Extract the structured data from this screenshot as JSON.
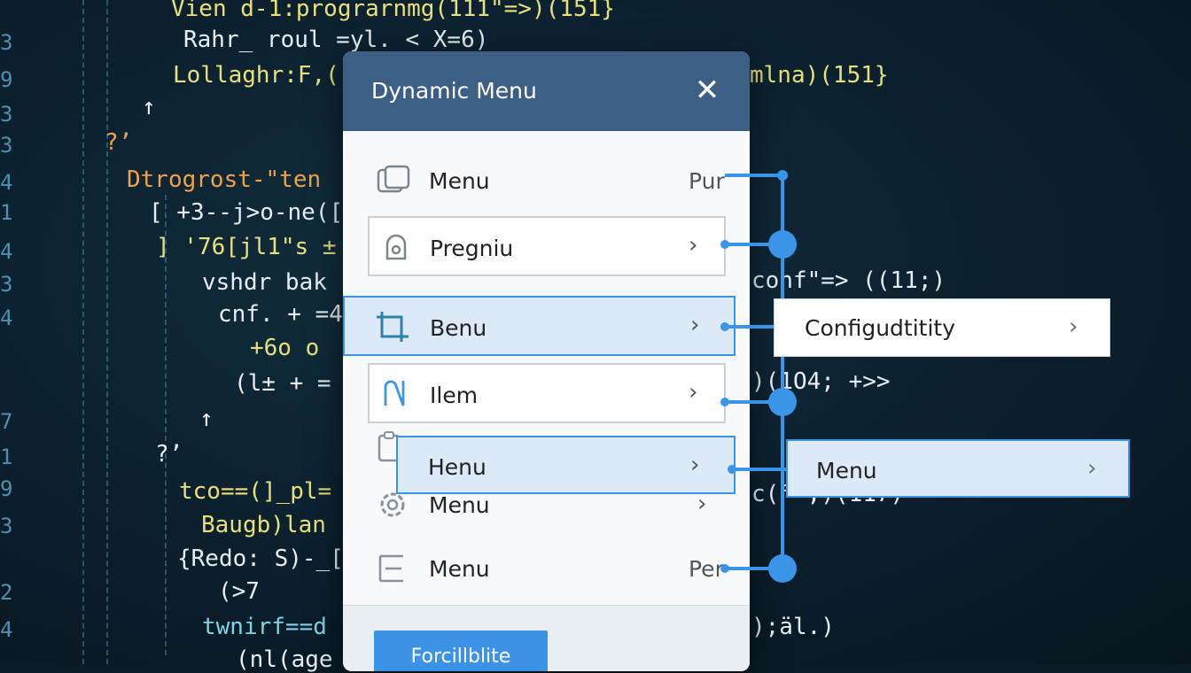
{
  "colors": {
    "header_bg": "#3d5e85",
    "accent": "#3a95e8",
    "highlight_bg": "#dceaf8",
    "code_bg": "#0c2230"
  },
  "background_code": {
    "lines": [
      "Vien d-1:prograrnmg(111\"=>)(151}",
      "Rahr_ roul =yl. < X=6)",
      "Lollaghr:F,(",
      "mlna)(151}",
      "↑",
      "?ʼ",
      "Dtrogrost-\"ten",
      "[ +3--j>o-ne([",
      "] '76[jl1\"s ±",
      "vshdr bak",
      "cnf. + =4",
      "+6o o",
      "(l± + =",
      "↑",
      "?ʼ",
      "tco==(]_pl=",
      "Baugb)lan",
      "{Redo: S)-_[",
      "(>7",
      "twnirf==d",
      "(nl(age",
      "conf\"=> ((11;)",
      ")(1O4; +>>",
      "c(° ,)(117)",
      ");äl.)"
    ],
    "line_numbers": [
      "3",
      "9",
      "3",
      "3",
      "4",
      "1",
      "4",
      "3",
      "4",
      "7",
      "1",
      "9",
      "3",
      "2",
      "4"
    ]
  },
  "menu": {
    "title": "Dynamic Menu",
    "close_icon": "close-icon",
    "items": [
      {
        "label": "Menu",
        "trail": "Pur",
        "icon": "copy-icon"
      },
      {
        "label": "Pregniu",
        "trail": "›",
        "icon": "lock-icon"
      },
      {
        "label": "Benu",
        "trail": "›",
        "icon": "crop-icon"
      },
      {
        "label": "Ilem",
        "trail": "›",
        "icon": "bracket-icon"
      },
      {
        "label": "Henu",
        "trail": "›",
        "icon": "clipboard-icon"
      },
      {
        "label": "Menu",
        "trail": "›",
        "icon": "gear-icon"
      },
      {
        "label": "Menu",
        "trail": "Per",
        "icon": "list-icon"
      }
    ],
    "footer_button": "Forcillblite"
  },
  "submenus": [
    {
      "label": "Configudtitity",
      "chevron": "›"
    },
    {
      "label": "Menu",
      "chevron": "›"
    }
  ]
}
